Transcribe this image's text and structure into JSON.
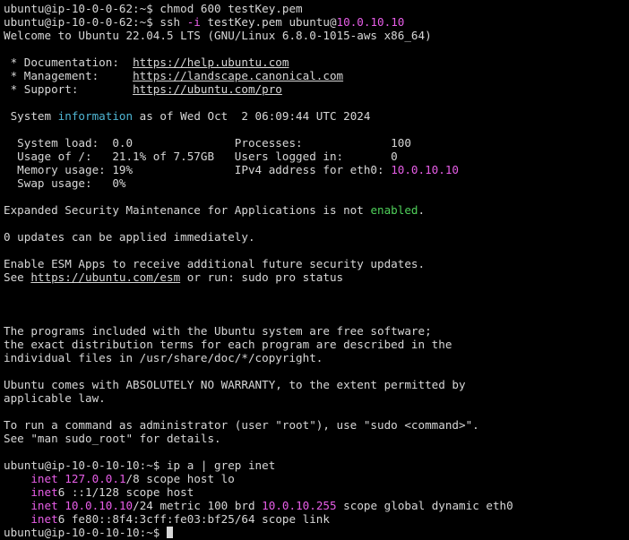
{
  "terminal": {
    "colors": {
      "background": "#000000",
      "foreground": "#d7d7d7",
      "magenta": "#e85ee8",
      "cyan": "#4fb6d4",
      "green": "#4fd05a"
    },
    "lines": [
      [
        {
          "t": "ubuntu@ip-10-0-0-62:~$ chmod 600 testKey.pem"
        }
      ],
      [
        {
          "t": "ubuntu@ip-10-0-0-62:~$ ssh "
        },
        {
          "t": "-i",
          "c": "magenta"
        },
        {
          "t": " testKey.pem ubuntu@"
        },
        {
          "t": "10.0.10.10",
          "c": "magenta"
        }
      ],
      [
        {
          "t": "Welcome to Ubuntu 22.04.5 LTS (GNU/Linux 6.8.0-1015-aws x86_64)"
        }
      ],
      [
        {
          "t": ""
        }
      ],
      [
        {
          "t": " * Documentation:  "
        },
        {
          "t": "https://help.ubuntu.com",
          "u": true
        }
      ],
      [
        {
          "t": " * Management:     "
        },
        {
          "t": "https://landscape.canonical.com",
          "u": true
        }
      ],
      [
        {
          "t": " * Support:        "
        },
        {
          "t": "https://ubuntu.com/pro",
          "u": true
        }
      ],
      [
        {
          "t": ""
        }
      ],
      [
        {
          "t": " System "
        },
        {
          "t": "information",
          "c": "cyan"
        },
        {
          "t": " as of Wed Oct  2 06:09:44 UTC 2024"
        }
      ],
      [
        {
          "t": ""
        }
      ],
      [
        {
          "t": "  System load:  0.0               Processes:             100"
        }
      ],
      [
        {
          "t": "  Usage of /:   21.1% of 7.57GB   Users logged in:       0"
        }
      ],
      [
        {
          "t": "  Memory usage: 19%               IPv4 address for eth0: "
        },
        {
          "t": "10.0.10.10",
          "c": "magenta"
        }
      ],
      [
        {
          "t": "  Swap usage:   0%"
        }
      ],
      [
        {
          "t": ""
        }
      ],
      [
        {
          "t": "Expanded Security Maintenance for Applications is not "
        },
        {
          "t": "enabled",
          "c": "green"
        },
        {
          "t": "."
        }
      ],
      [
        {
          "t": ""
        }
      ],
      [
        {
          "t": "0 updates can be applied immediately."
        }
      ],
      [
        {
          "t": ""
        }
      ],
      [
        {
          "t": "Enable ESM Apps to receive additional future security updates."
        }
      ],
      [
        {
          "t": "See "
        },
        {
          "t": "https://ubuntu.com/esm",
          "u": true
        },
        {
          "t": " or run: sudo pro status"
        }
      ],
      [
        {
          "t": ""
        }
      ],
      [
        {
          "t": ""
        }
      ],
      [
        {
          "t": ""
        }
      ],
      [
        {
          "t": "The programs included with the Ubuntu system are free software;"
        }
      ],
      [
        {
          "t": "the exact distribution terms for each program are described in the"
        }
      ],
      [
        {
          "t": "individual files in /usr/share/doc/*/copyright."
        }
      ],
      [
        {
          "t": ""
        }
      ],
      [
        {
          "t": "Ubuntu comes with ABSOLUTELY NO WARRANTY, to the extent permitted by"
        }
      ],
      [
        {
          "t": "applicable law."
        }
      ],
      [
        {
          "t": ""
        }
      ],
      [
        {
          "t": "To run a command as administrator (user \"root\"), use \"sudo <command>\"."
        }
      ],
      [
        {
          "t": "See \"man sudo_root\" for details."
        }
      ],
      [
        {
          "t": ""
        }
      ],
      [
        {
          "t": "ubuntu@ip-10-0-10-10:~$ ip a | grep inet"
        }
      ],
      [
        {
          "t": "    "
        },
        {
          "t": "inet",
          "c": "magenta"
        },
        {
          "t": " "
        },
        {
          "t": "127.0.0.1",
          "c": "magenta"
        },
        {
          "t": "/8 scope host lo"
        }
      ],
      [
        {
          "t": "    "
        },
        {
          "t": "inet",
          "c": "magenta"
        },
        {
          "t": "6 ::1/128 scope host"
        }
      ],
      [
        {
          "t": "    "
        },
        {
          "t": "inet",
          "c": "magenta"
        },
        {
          "t": " "
        },
        {
          "t": "10.0.10.10",
          "c": "magenta"
        },
        {
          "t": "/24 metric 100 brd "
        },
        {
          "t": "10.0.10.255",
          "c": "magenta"
        },
        {
          "t": " scope global dynamic eth0"
        }
      ],
      [
        {
          "t": "    "
        },
        {
          "t": "inet",
          "c": "magenta"
        },
        {
          "t": "6 fe80::8f4:3cff:fe03:bf25/64 scope link"
        }
      ],
      [
        {
          "t": "ubuntu@ip-10-0-10-10:~$ "
        },
        {
          "cursor": true
        }
      ]
    ]
  }
}
